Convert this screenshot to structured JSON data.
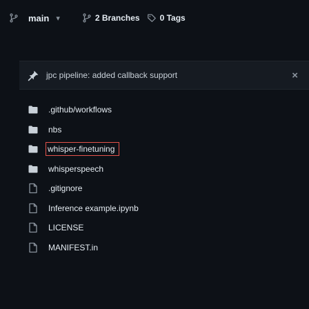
{
  "header": {
    "branch": "main",
    "branches_label": "2 Branches",
    "tags_label": "0 Tags"
  },
  "notice": {
    "text": "jpc pipeline: added callback support",
    "close": "×"
  },
  "files": [
    {
      "name": ".github/workflows",
      "type": "folder"
    },
    {
      "name": "nbs",
      "type": "folder"
    },
    {
      "name": "whisper-finetuning",
      "type": "folder"
    },
    {
      "name": "whisperspeech",
      "type": "folder"
    },
    {
      "name": ".gitignore",
      "type": "file"
    },
    {
      "name": "Inference example.ipynb",
      "type": "file"
    },
    {
      "name": "LICENSE",
      "type": "file"
    },
    {
      "name": "MANIFEST.in",
      "type": "file"
    }
  ],
  "colors": {
    "background": "#0d1117",
    "folder_icon": "#c9d1d9",
    "highlight_box": "#e5534b"
  },
  "icons": {
    "branch": "git-branch-icon",
    "tag": "tag-icon",
    "notice": "pin-icon",
    "folder": "folder-icon",
    "file": "file-icon"
  }
}
